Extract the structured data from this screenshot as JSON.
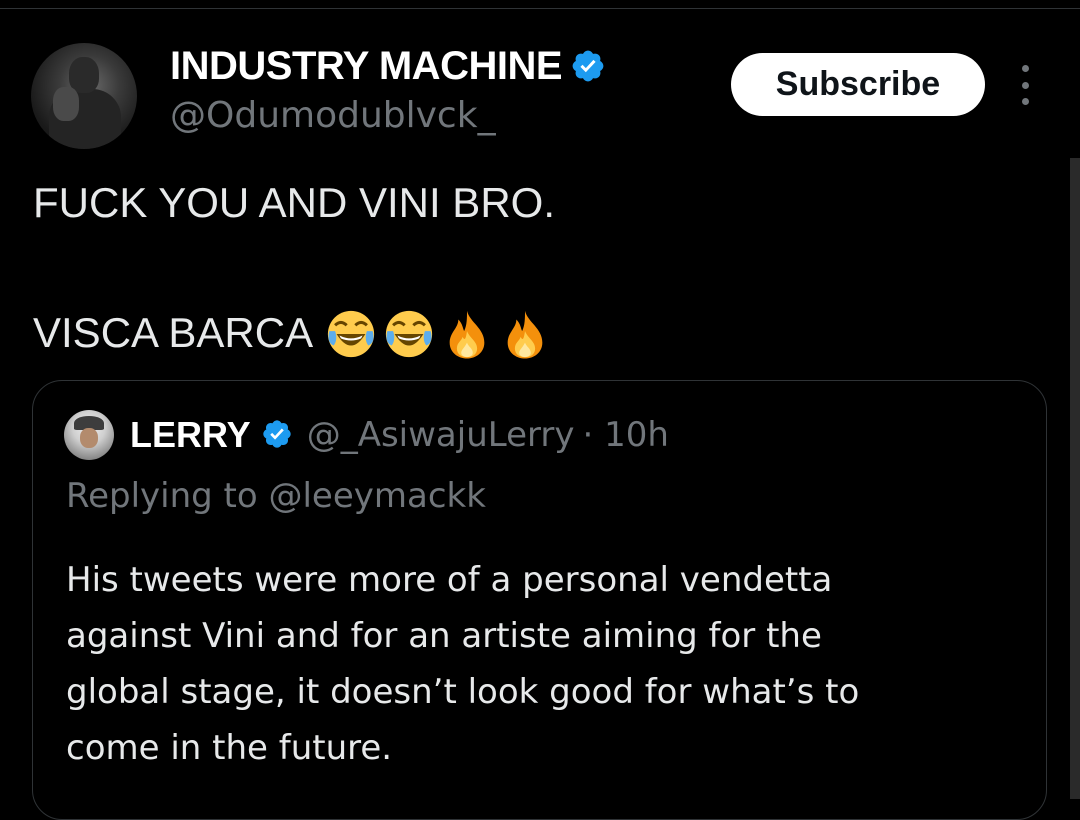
{
  "tweet": {
    "author": {
      "display_name": "INDUSTRY MACHINE",
      "handle": "@Odumodublvck_",
      "verified": true
    },
    "subscribe_label": "Subscribe",
    "text_lines": [
      "FUCK YOU AND VINI BRO.",
      "",
      "VISCA BARCA"
    ],
    "emojis": [
      "face-with-tears-of-joy",
      "face-with-tears-of-joy",
      "fire",
      "fire"
    ]
  },
  "quoted_tweet": {
    "author": {
      "display_name": "LERRY",
      "handle": "@_AsiwajuLerry",
      "verified": true
    },
    "timestamp": "· 10h",
    "replying_to": "Replying to @leeymackk",
    "text_lines": [
      "His tweets were more of a personal vendetta",
      "against Vini and for an artiste aiming for the",
      "global stage, it doesn’t look good for what’s to",
      "come in the future."
    ]
  },
  "colors": {
    "background": "#000000",
    "text_primary": "#e7e9ea",
    "text_secondary": "#71767b",
    "verified_blue": "#1d9bf0",
    "border": "#2f3336"
  }
}
